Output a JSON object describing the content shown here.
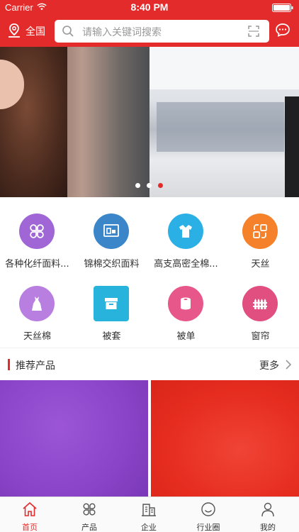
{
  "status_bar": {
    "carrier": "Carrier",
    "time": "8:40 PM"
  },
  "header": {
    "location": "全国",
    "search_placeholder": "请输入关键词搜索"
  },
  "banner": {
    "slide_count": 3,
    "active_slide": 3
  },
  "categories": [
    {
      "label": "各种化纤面料...",
      "icon": "clover-icon",
      "color": "#a066d6"
    },
    {
      "label": "锦棉交织面料",
      "icon": "window-icon",
      "color": "#3a86c8"
    },
    {
      "label": "高支高密全棉...",
      "icon": "shirt-icon",
      "color": "#2bb0e6"
    },
    {
      "label": "天丝",
      "icon": "swap-icon",
      "color": "#f5822a"
    },
    {
      "label": "天丝棉",
      "icon": "dress-icon",
      "color": "#b87ee0"
    },
    {
      "label": "被套",
      "icon": "box-icon",
      "color": "#27b3dc"
    },
    {
      "label": "被单",
      "icon": "roll-icon",
      "color": "#e8578a"
    },
    {
      "label": "窗帘",
      "icon": "fence-icon",
      "color": "#e04f7f"
    }
  ],
  "recommend": {
    "title": "推荐产品",
    "more": "更多"
  },
  "tabs": [
    {
      "label": "首页",
      "icon": "home-icon",
      "active": true
    },
    {
      "label": "产品",
      "icon": "grid-icon",
      "active": false
    },
    {
      "label": "企业",
      "icon": "building-icon",
      "active": false
    },
    {
      "label": "行业圈",
      "icon": "smile-icon",
      "active": false
    },
    {
      "label": "我的",
      "icon": "person-icon",
      "active": false
    }
  ],
  "colors": {
    "brand": "#e42b2b",
    "tab_active": "#e42b2b"
  }
}
